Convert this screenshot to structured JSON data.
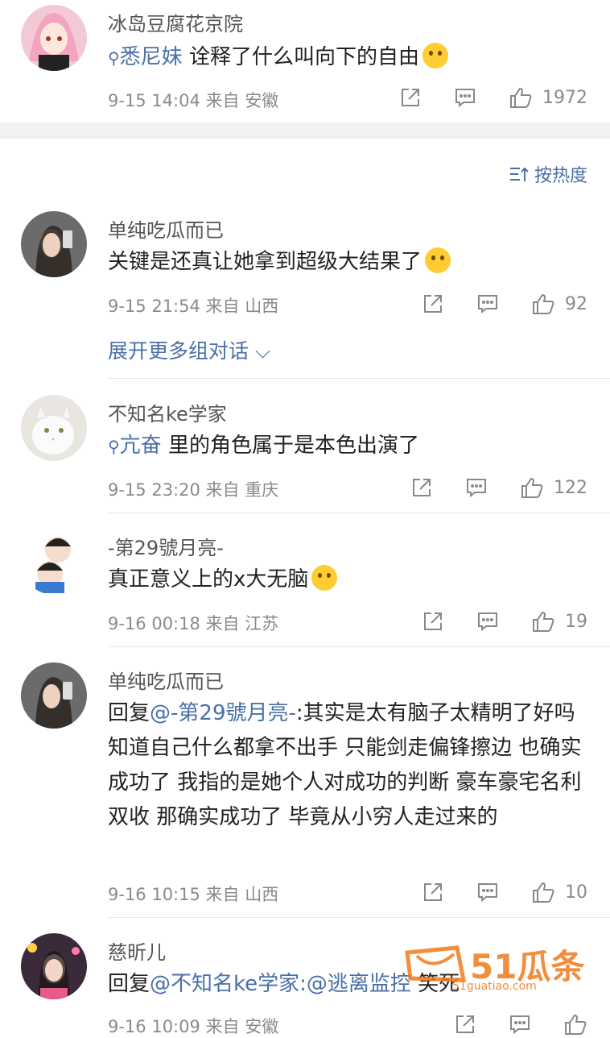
{
  "sort_label": "按热度",
  "expand_label": "展开更多组对话",
  "comments": [
    {
      "user": "冰岛豆腐花京院",
      "link": "悉尼妹",
      "text": "诠释了什么叫向下的自由",
      "meta": "9-15 14:04 来自 安徽",
      "likes": "1972"
    },
    {
      "user": "单纯吃瓜而已",
      "text": "关键是还真让她拿到超级大结果了",
      "meta": "9-15 21:54 来自 山西",
      "likes": "92"
    },
    {
      "user": "不知名ke学家",
      "link": "亢奋",
      "text": "里的角色属于是本色出演了",
      "meta": "9-15 23:20 来自 重庆",
      "likes": "122"
    },
    {
      "user": "-第29號月亮-",
      "text": "真正意义上的x大无脑",
      "meta": "9-16 00:18 来自 江苏",
      "likes": "19"
    },
    {
      "user": "单纯吃瓜而已",
      "reply_prefix": "回复",
      "reply_to": "@-第29號月亮-",
      "text": ":其实是太有脑子太精明了好吗 知道自己什么都拿不出手 只能剑走偏锋擦边 也确实成功了 我指的是她个人对成功的判断 豪车豪宅名利双收 那确实成功了 毕竟从小穷人走过来的",
      "meta": "9-16 10:15 来自 山西",
      "likes": "10"
    },
    {
      "user": "慈昕儿",
      "reply_prefix": "回复",
      "reply_to": "@不知名ke学家",
      "reply_to2": ":@逃离监控",
      "text": " 笑死",
      "meta": "9-16 10:09 来自 安徽",
      "likes": ""
    }
  ],
  "watermark": {
    "brand": "51瓜条",
    "site": "51guatiao.com"
  },
  "colors": {
    "link": "#4a6fa8",
    "muted": "#8a8a8a",
    "watermark": "#f07a1a"
  }
}
